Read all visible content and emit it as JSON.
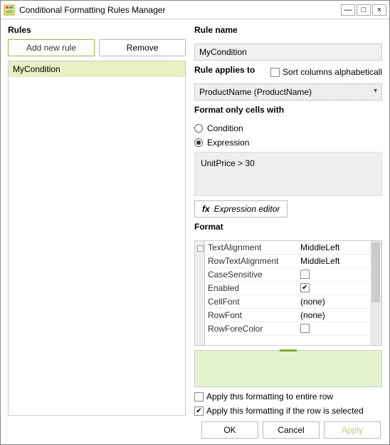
{
  "window": {
    "title": "Conditional Formatting Rules Manager"
  },
  "sections": {
    "rules": "Rules",
    "ruleName": "Rule name",
    "ruleApplies": "Rule applies to",
    "formatOnly": "Format only cells with",
    "format": "Format"
  },
  "buttons": {
    "addRule": "Add new rule",
    "remove": "Remove",
    "exprEditor": "Expression editor",
    "ok": "OK",
    "cancel": "Cancel",
    "apply": "Apply"
  },
  "rulesList": [
    {
      "name": "MyCondition"
    }
  ],
  "ruleName": {
    "value": "MyCondition"
  },
  "sortAlpha": {
    "label": "Sort columns alphabeticall",
    "checked": false
  },
  "appliesTo": {
    "value": "ProductName (ProductName)"
  },
  "formatOnly": {
    "condition": {
      "label": "Condition",
      "selected": false
    },
    "expression": {
      "label": "Expression",
      "selected": true
    }
  },
  "expression": {
    "value": "UnitPrice > 30"
  },
  "propGrid": [
    {
      "k": "TextAlignment",
      "v": "MiddleLeft",
      "type": "text"
    },
    {
      "k": "RowTextAlignment",
      "v": "MiddleLeft",
      "type": "text"
    },
    {
      "k": "CaseSensitive",
      "v": false,
      "type": "check"
    },
    {
      "k": "Enabled",
      "v": true,
      "type": "check"
    },
    {
      "k": "CellFont",
      "v": "(none)",
      "type": "text"
    },
    {
      "k": "RowFont",
      "v": "(none)",
      "type": "text"
    },
    {
      "k": "RowForeColor",
      "v": "",
      "type": "color"
    }
  ],
  "checkboxes": {
    "entireRow": {
      "label": "Apply this formatting to entire row",
      "checked": false
    },
    "ifSelected": {
      "label": "Apply this formatting if the row is selected",
      "checked": true
    }
  }
}
